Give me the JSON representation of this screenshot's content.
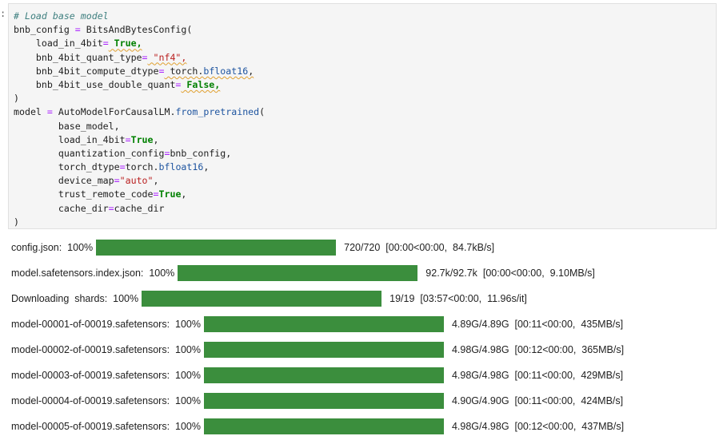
{
  "cell": {
    "prompt_marker": ":",
    "code_lines": [
      [
        {
          "t": "# Load base model",
          "c": "c"
        }
      ],
      [
        {
          "t": "bnb_config "
        },
        {
          "t": "=",
          "c": "op"
        },
        {
          "t": " BitsAndBytesConfig("
        }
      ],
      [
        {
          "t": "    load_in_4bit"
        },
        {
          "t": "=",
          "c": "op"
        },
        {
          "t": " True,",
          "c": "kw squig"
        }
      ],
      [
        {
          "t": "    bnb_4bit_quant_type"
        },
        {
          "t": "=",
          "c": "op"
        },
        {
          "t": " \"nf4\",",
          "c": "str squig"
        }
      ],
      [
        {
          "t": "    bnb_4bit_compute_dtype"
        },
        {
          "t": "=",
          "c": "op"
        },
        {
          "t": " torch.",
          "c": "squig"
        },
        {
          "t": "bfloat16",
          "c": "attr squig"
        },
        {
          "t": ",",
          "c": "squig"
        }
      ],
      [
        {
          "t": "    bnb_4bit_use_double_quant"
        },
        {
          "t": "=",
          "c": "op"
        },
        {
          "t": " False,",
          "c": "kw squig"
        }
      ],
      [
        {
          "t": ")"
        }
      ],
      [
        {
          "t": "model "
        },
        {
          "t": "=",
          "c": "op"
        },
        {
          "t": " AutoModelForCausalLM."
        },
        {
          "t": "from_pretrained",
          "c": "attr"
        },
        {
          "t": "("
        }
      ],
      [
        {
          "t": "        base_model,"
        }
      ],
      [
        {
          "t": "        load_in_4bit"
        },
        {
          "t": "=",
          "c": "op"
        },
        {
          "t": "True",
          "c": "kw"
        },
        {
          "t": ","
        }
      ],
      [
        {
          "t": "        quantization_config"
        },
        {
          "t": "=",
          "c": "op"
        },
        {
          "t": "bnb_config,"
        }
      ],
      [
        {
          "t": "        torch_dtype"
        },
        {
          "t": "=",
          "c": "op"
        },
        {
          "t": "torch."
        },
        {
          "t": "bfloat16",
          "c": "attr"
        },
        {
          "t": ","
        }
      ],
      [
        {
          "t": "        device_map"
        },
        {
          "t": "=",
          "c": "op"
        },
        {
          "t": "\"auto\"",
          "c": "str"
        },
        {
          "t": ","
        }
      ],
      [
        {
          "t": "        trust_remote_code"
        },
        {
          "t": "=",
          "c": "op"
        },
        {
          "t": "True",
          "c": "kw"
        },
        {
          "t": ","
        }
      ],
      [
        {
          "t": "        cache_dir"
        },
        {
          "t": "=",
          "c": "op"
        },
        {
          "t": "cache_dir"
        }
      ],
      [
        {
          "t": ")"
        }
      ]
    ]
  },
  "progress_rows": [
    {
      "label": "config.json:  100%",
      "progress": 1.0,
      "stats": "720/720  [00:00<00:00,  84.7kB/s]"
    },
    {
      "label": "model.safetensors.index.json:  100%",
      "progress": 1.0,
      "stats": "92.7k/92.7k  [00:00<00:00,  9.10MB/s]"
    },
    {
      "label": "Downloading  shards:  100%",
      "progress": 1.0,
      "stats": "19/19  [03:57<00:00,  11.96s/it]"
    },
    {
      "label": "model-00001-of-00019.safetensors:  100%",
      "progress": 1.0,
      "stats": "4.89G/4.89G  [00:11<00:00,  435MB/s]"
    },
    {
      "label": "model-00002-of-00019.safetensors:  100%",
      "progress": 1.0,
      "stats": "4.98G/4.98G  [00:12<00:00,  365MB/s]"
    },
    {
      "label": "model-00003-of-00019.safetensors:  100%",
      "progress": 1.0,
      "stats": "4.98G/4.98G  [00:11<00:00,  429MB/s]"
    },
    {
      "label": "model-00004-of-00019.safetensors:  100%",
      "progress": 1.0,
      "stats": "4.90G/4.90G  [00:11<00:00,  424MB/s]"
    },
    {
      "label": "model-00005-of-00019.safetensors:  100%",
      "progress": 1.0,
      "stats": "4.98G/4.98G  [00:12<00:00,  437MB/s]"
    }
  ],
  "colors": {
    "progress_fill": "#3b8e3d"
  }
}
